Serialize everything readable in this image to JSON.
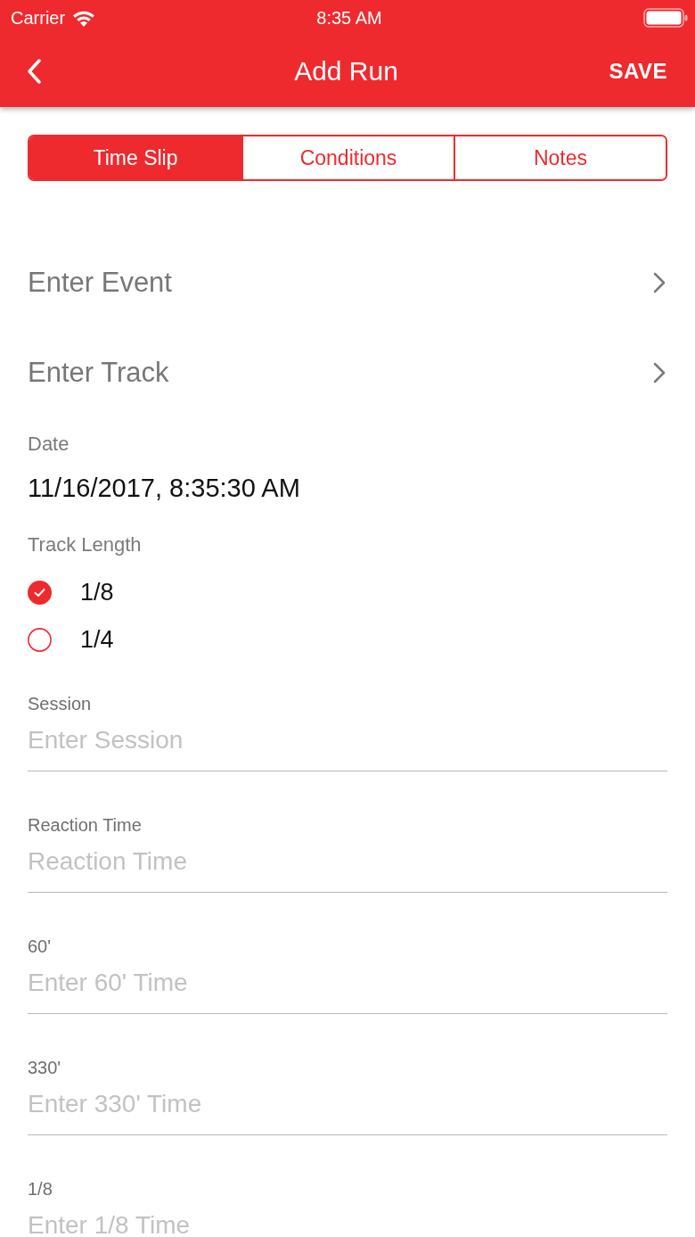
{
  "status_bar": {
    "carrier": "Carrier",
    "time": "8:35 AM"
  },
  "nav_bar": {
    "title": "Add Run",
    "action": "SAVE"
  },
  "tabs": [
    {
      "label": "Time Slip",
      "selected": true
    },
    {
      "label": "Conditions",
      "selected": false
    },
    {
      "label": "Notes",
      "selected": false
    }
  ],
  "pickers": [
    {
      "label": "Enter Event"
    },
    {
      "label": "Enter Track"
    }
  ],
  "date": {
    "label": "Date",
    "value": "11/16/2017, 8:35:30 AM"
  },
  "track_length": {
    "label": "Track Length",
    "options": [
      {
        "label": "1/8",
        "selected": true
      },
      {
        "label": "1/4",
        "selected": false
      }
    ]
  },
  "fields": [
    {
      "label": "Session",
      "placeholder": "Enter Session"
    },
    {
      "label": "Reaction Time",
      "placeholder": "Reaction Time"
    },
    {
      "label": "60'",
      "placeholder": "Enter 60' Time"
    },
    {
      "label": "330'",
      "placeholder": "Enter 330' Time"
    },
    {
      "label": "1/8",
      "placeholder": "Enter 1/8 Time"
    }
  ]
}
